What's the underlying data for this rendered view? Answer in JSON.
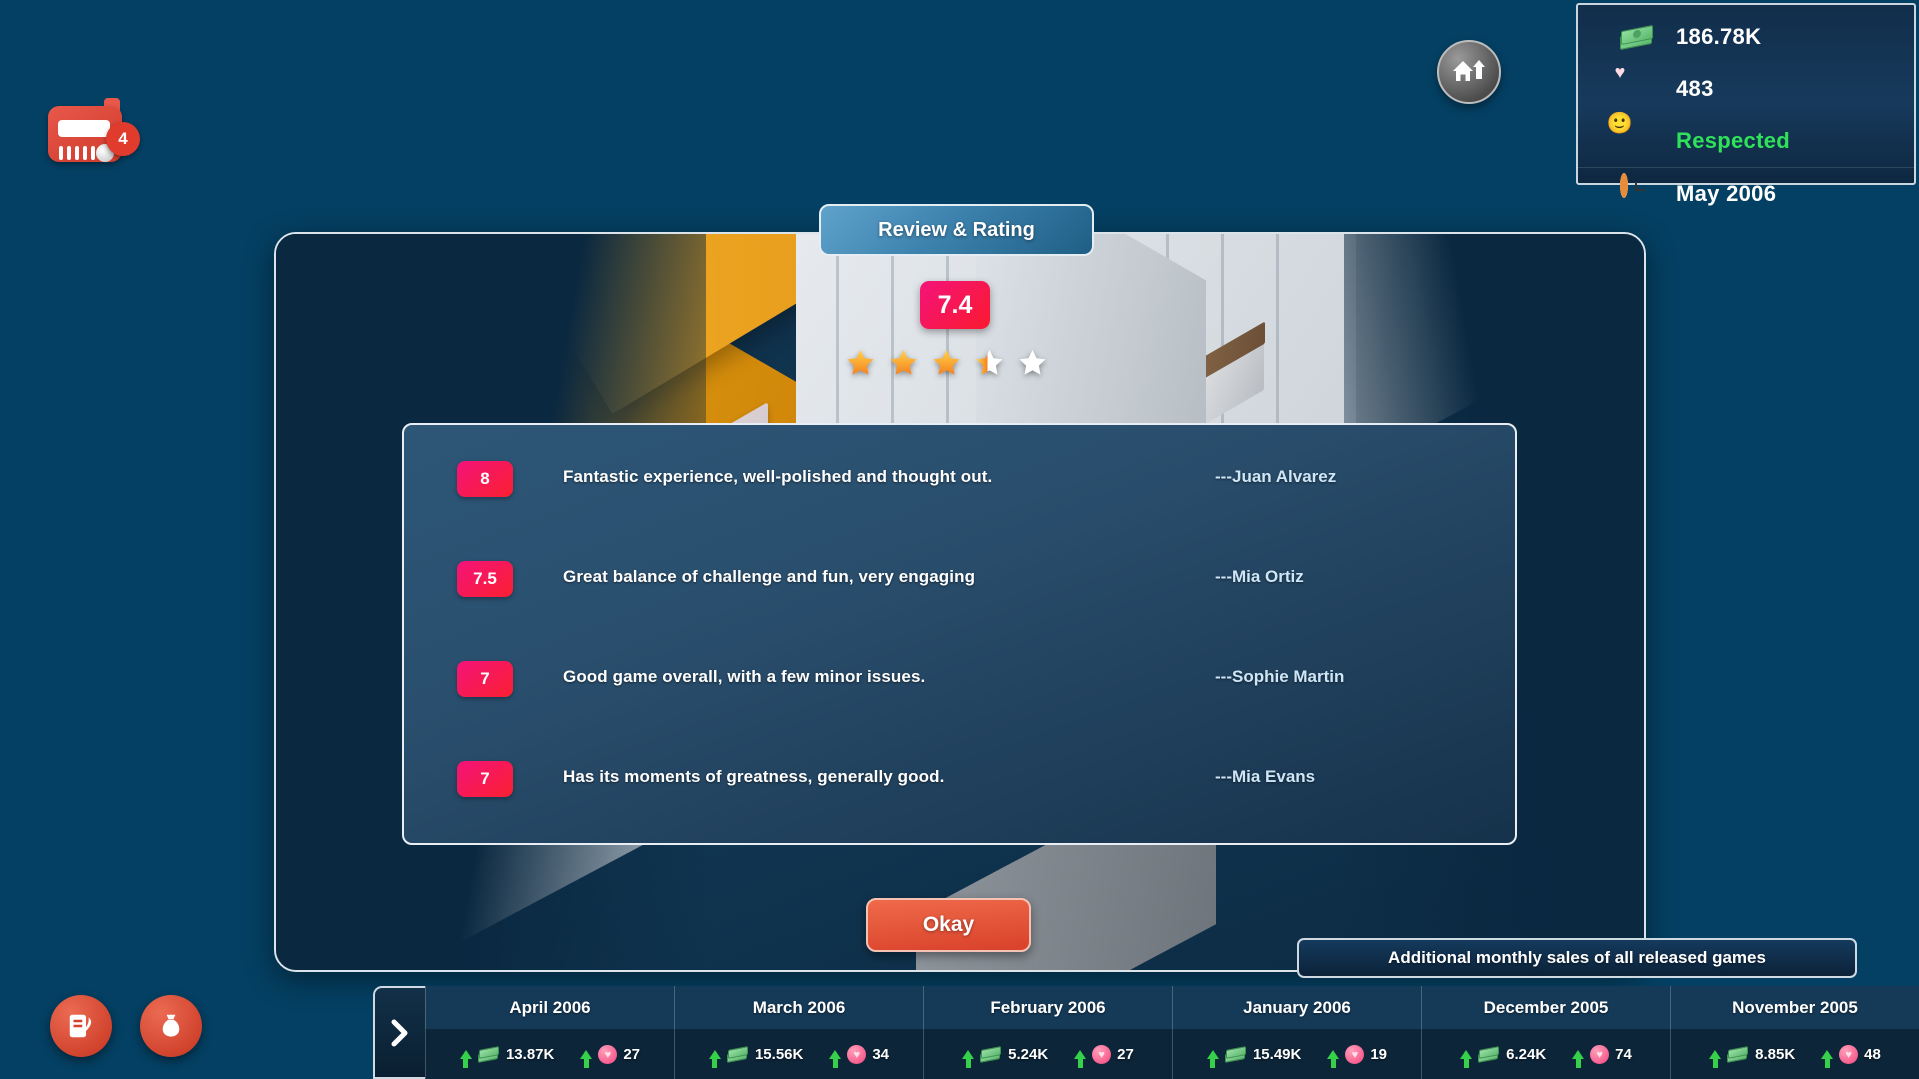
{
  "hud": {
    "mail_badge_count": "4",
    "stats": [
      {
        "icon": "money-icon",
        "value": "186.78K",
        "color": "#ffffff"
      },
      {
        "icon": "heart-icon",
        "value": "483",
        "color": "#ffffff"
      },
      {
        "icon": "smiley-icon",
        "value": "Respected",
        "color": "#2fe25a"
      },
      {
        "icon": "clock-icon",
        "value": "May 2006",
        "color": "#ffffff"
      }
    ]
  },
  "dialog": {
    "tab_title": "Review & Rating",
    "rating_score": "7.4",
    "stars_filled": 3,
    "stars_half": 1,
    "stars_total": 5,
    "reviews": [
      {
        "score": "8",
        "text": "Fantastic experience, well-polished and thought out.",
        "author": "---Juan Alvarez"
      },
      {
        "score": "7.5",
        "text": "Great balance of challenge and fun, very engaging",
        "author": "---Mia Ortiz"
      },
      {
        "score": "7",
        "text": "Good game overall, with a few minor issues.",
        "author": "---Sophie Martin"
      },
      {
        "score": "7",
        "text": "Has its moments of greatness, generally good.",
        "author": "---Mia Evans"
      }
    ],
    "okay_label": "Okay"
  },
  "tooltip": {
    "text": "Additional monthly sales of all released games"
  },
  "timeline": {
    "prev_label": "›",
    "months": [
      {
        "name": "April 2006",
        "sales": "13.87K",
        "fans": "27"
      },
      {
        "name": "March 2006",
        "sales": "15.56K",
        "fans": "34"
      },
      {
        "name": "February 2006",
        "sales": "5.24K",
        "fans": "27"
      },
      {
        "name": "January 2006",
        "sales": "15.49K",
        "fans": "19"
      },
      {
        "name": "December 2005",
        "sales": "6.24K",
        "fans": "74"
      },
      {
        "name": "November 2005",
        "sales": "8.85K",
        "fans": "48"
      }
    ]
  },
  "colors": {
    "background": "#044063",
    "accent_pink": "#f4137a",
    "accent_red": "#d9412a",
    "status_green": "#2fe25a",
    "panel_blue": "#153a58"
  }
}
